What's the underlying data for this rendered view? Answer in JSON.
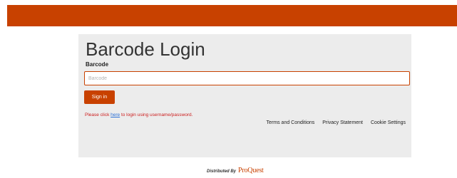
{
  "header": {
    "bar_color": "#c84100"
  },
  "login": {
    "title": "Barcode Login",
    "field_label": "Barcode",
    "field_placeholder": "Barcode",
    "field_value": "",
    "signin_label": "Sign in",
    "alt_prefix": "Please click ",
    "alt_link": "here",
    "alt_suffix": " to login using username/password."
  },
  "footer": {
    "links": [
      "Terms and Conditions",
      "Privacy Statement",
      "Cookie Settings"
    ]
  },
  "credit": {
    "text": "Distributed By",
    "brand": "ProQuest"
  },
  "colors": {
    "accent": "#c84100",
    "panel_bg": "#ececec",
    "alert_text": "#cc1e1e",
    "link": "#2a6fd6"
  }
}
